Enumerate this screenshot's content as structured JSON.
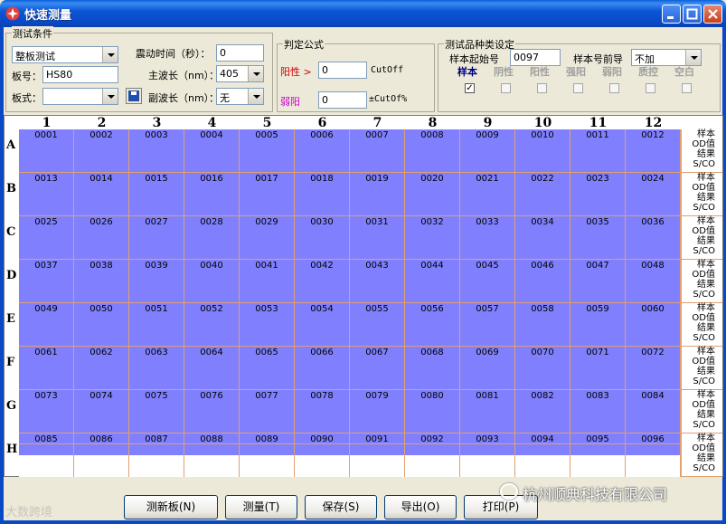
{
  "window": {
    "title": "快速测量"
  },
  "conditions": {
    "group_title": "测试条件",
    "mode_value": "整板测试",
    "plate_no_label": "板号：",
    "plate_no_value": "HS80",
    "plate_type_label": "板式：",
    "plate_type_value": "",
    "shake_time_label": "震动时间（秒）：",
    "shake_time_value": "0",
    "main_wave_label": "主波长（nm）：",
    "main_wave_value": "405",
    "sub_wave_label": "副波长（nm）：",
    "sub_wave_value": "无"
  },
  "formula": {
    "group_title": "判定公式",
    "positive_label": "阳性 >",
    "positive_value": "0",
    "positive_unit": "CutOff",
    "weak_label": "弱阳",
    "weak_value": "0",
    "weak_unit": "±CutOf%"
  },
  "sample_type": {
    "group_title": "测试品种类设定",
    "start_label": "样本起始号",
    "start_value": "0097",
    "prefix_label": "样本号前导",
    "prefix_value": "不加",
    "types": [
      {
        "label": "样本",
        "checked": true
      },
      {
        "label": "阴性",
        "checked": false
      },
      {
        "label": "阳性",
        "checked": false
      },
      {
        "label": "强阳",
        "checked": false
      },
      {
        "label": "弱阳",
        "checked": false
      },
      {
        "label": "质控",
        "checked": false
      },
      {
        "label": "空白",
        "checked": false
      }
    ]
  },
  "plate": {
    "columns": [
      "1",
      "2",
      "3",
      "4",
      "5",
      "6",
      "7",
      "8",
      "9",
      "10",
      "11",
      "12"
    ],
    "rows": [
      "A",
      "B",
      "C",
      "D",
      "E",
      "F",
      "G",
      "H"
    ],
    "row_legend": [
      "样本",
      "OD值",
      "结果",
      "S/CO"
    ],
    "wells": [
      [
        "0001",
        "0002",
        "0003",
        "0004",
        "0005",
        "0006",
        "0007",
        "0008",
        "0009",
        "0010",
        "0011",
        "0012"
      ],
      [
        "0013",
        "0014",
        "0015",
        "0016",
        "0017",
        "0018",
        "0019",
        "0020",
        "0021",
        "0022",
        "0023",
        "0024"
      ],
      [
        "0025",
        "0026",
        "0027",
        "0028",
        "0029",
        "0030",
        "0031",
        "0032",
        "0033",
        "0034",
        "0035",
        "0036"
      ],
      [
        "0037",
        "0038",
        "0039",
        "0040",
        "0041",
        "0042",
        "0043",
        "0044",
        "0045",
        "0046",
        "0047",
        "0048"
      ],
      [
        "0049",
        "0050",
        "0051",
        "0052",
        "0053",
        "0054",
        "0055",
        "0056",
        "0057",
        "0058",
        "0059",
        "0060"
      ],
      [
        "0061",
        "0062",
        "0063",
        "0064",
        "0065",
        "0066",
        "0067",
        "0068",
        "0069",
        "0070",
        "0071",
        "0072"
      ],
      [
        "0073",
        "0074",
        "0075",
        "0076",
        "0077",
        "0078",
        "0079",
        "0080",
        "0081",
        "0082",
        "0083",
        "0084"
      ],
      [
        "0085",
        "0086",
        "0087",
        "0088",
        "0089",
        "0090",
        "0091",
        "0092",
        "0093",
        "0094",
        "0095",
        "0096"
      ]
    ]
  },
  "buttons": {
    "new_plate": "测新板(N)",
    "measure": "测量(T)",
    "save": "保存(S)",
    "export": "导出(O)",
    "print": "打印(P)"
  },
  "watermarks": {
    "left": "大数跨境",
    "right": "杭州顺典科技有限公司"
  },
  "colors": {
    "well_fill": "#8080ff",
    "grid_line": "#e0a070",
    "positive_label": "#cc0000",
    "weak_label": "#cc00cc",
    "type_active": "#000080"
  }
}
